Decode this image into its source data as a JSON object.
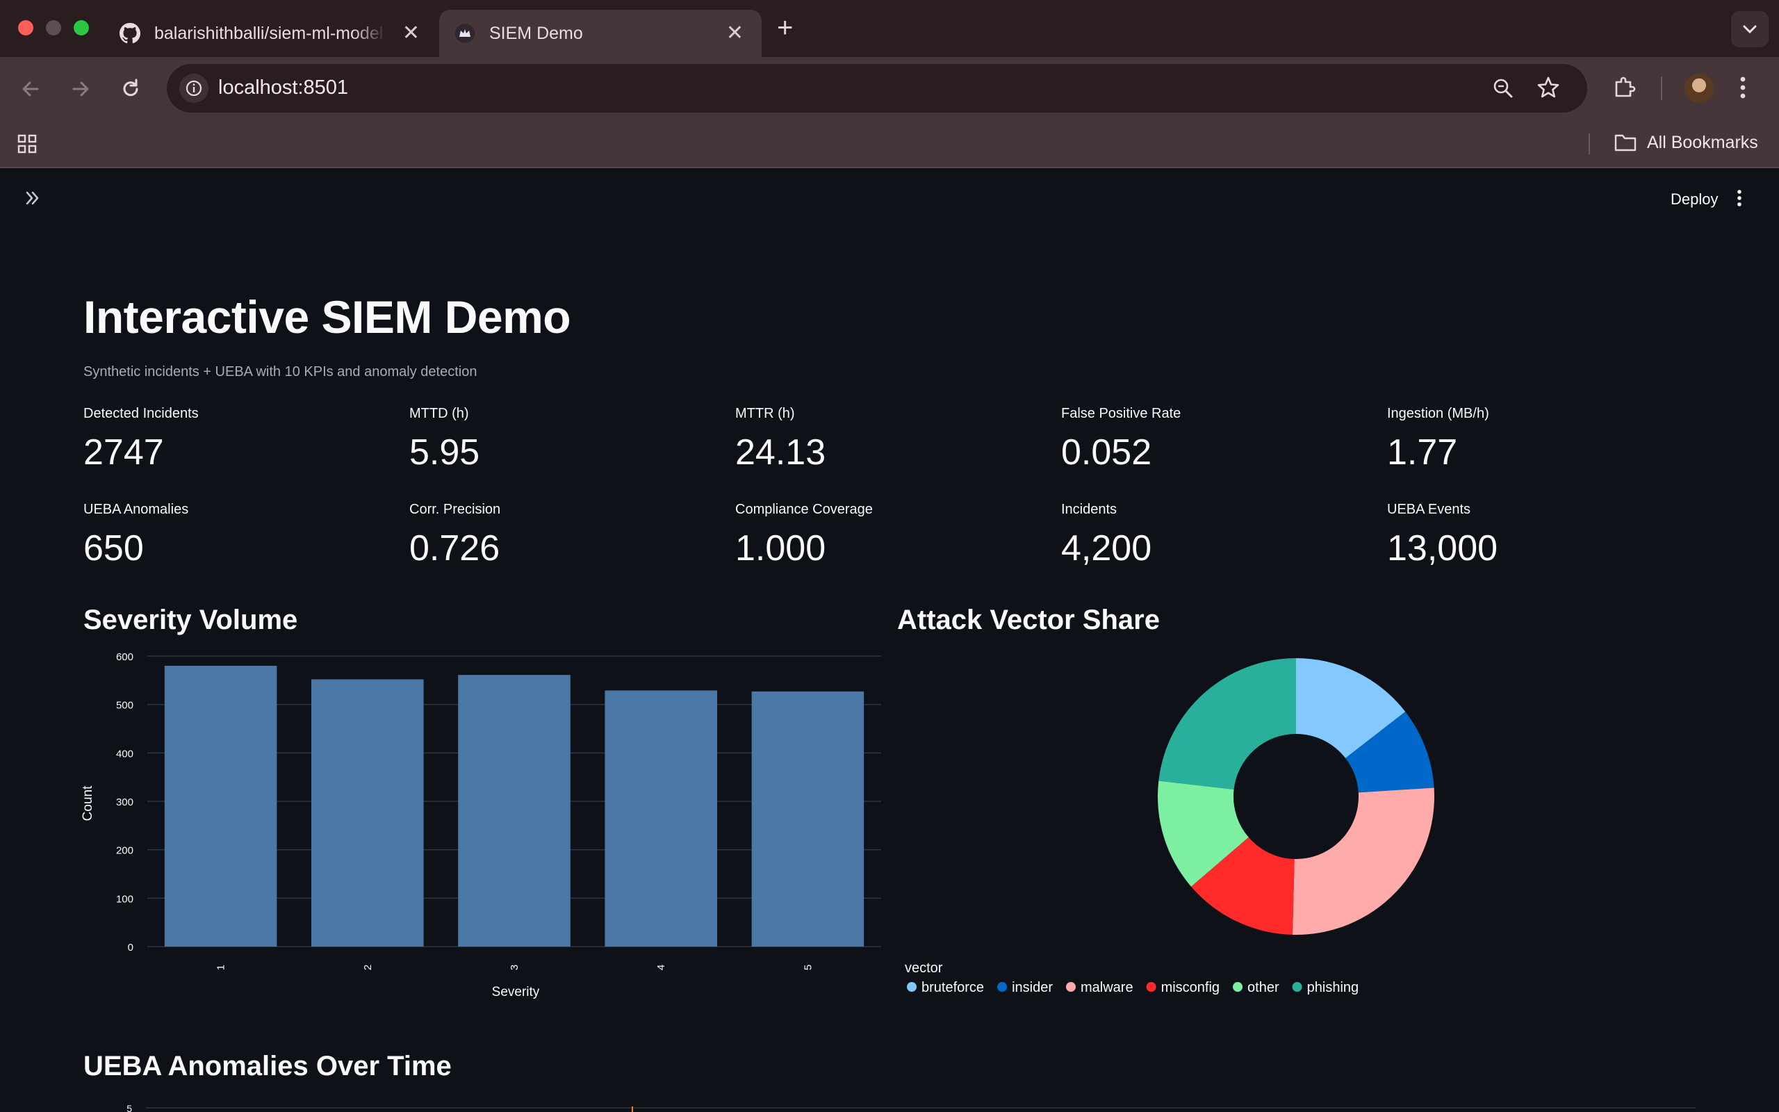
{
  "browser": {
    "tabs": [
      {
        "label": "balarishithballi/siem-ml-model",
        "active": false
      },
      {
        "label": "SIEM Demo",
        "active": true
      }
    ],
    "url": "localhost:8501",
    "bookmarks_label": "All Bookmarks"
  },
  "app": {
    "deploy_label": "Deploy",
    "title": "Interactive SIEM Demo",
    "caption": "Synthetic incidents + UEBA with 10 KPIs and anomaly detection",
    "metrics": [
      {
        "label": "Detected Incidents",
        "value": "2747"
      },
      {
        "label": "MTTD (h)",
        "value": "5.95"
      },
      {
        "label": "MTTR (h)",
        "value": "24.13"
      },
      {
        "label": "False Positive Rate",
        "value": "0.052"
      },
      {
        "label": "Ingestion (MB/h)",
        "value": "1.77"
      },
      {
        "label": "UEBA Anomalies",
        "value": "650"
      },
      {
        "label": "Corr. Precision",
        "value": "0.726"
      },
      {
        "label": "Compliance Coverage",
        "value": "1.000"
      },
      {
        "label": "Incidents",
        "value": "4,200"
      },
      {
        "label": "UEBA Events",
        "value": "13,000"
      }
    ],
    "sections": {
      "severity": "Severity Volume",
      "vector": "Attack Vector Share",
      "ueba": "UEBA Anomalies Over Time"
    }
  },
  "chart_data": [
    {
      "type": "bar",
      "title": "Severity Volume",
      "categories": [
        "1",
        "2",
        "3",
        "4",
        "5"
      ],
      "values": [
        580,
        552,
        561,
        529,
        527
      ],
      "xlabel": "Severity",
      "ylabel": "Count",
      "ylim": [
        0,
        600
      ],
      "yticks": [
        0,
        100,
        200,
        300,
        400,
        500,
        600
      ],
      "grid": true,
      "color": "#4c78a8"
    },
    {
      "type": "pie",
      "title": "Attack Vector Share",
      "donut": true,
      "legend_title": "vector",
      "legend_placement": "bottom-left",
      "categories": [
        "bruteforce",
        "insider",
        "malware",
        "misconfig",
        "other",
        "phishing"
      ],
      "values": [
        14.5,
        9.5,
        26.4,
        13.3,
        13.1,
        23.2
      ],
      "colors": [
        "#83c9ff",
        "#0068c9",
        "#ffabab",
        "#ff2b2b",
        "#7defa1",
        "#29b09d"
      ]
    },
    {
      "type": "line",
      "title": "UEBA Anomalies Over Time",
      "yticks_visible": [
        "5"
      ],
      "series": []
    }
  ]
}
